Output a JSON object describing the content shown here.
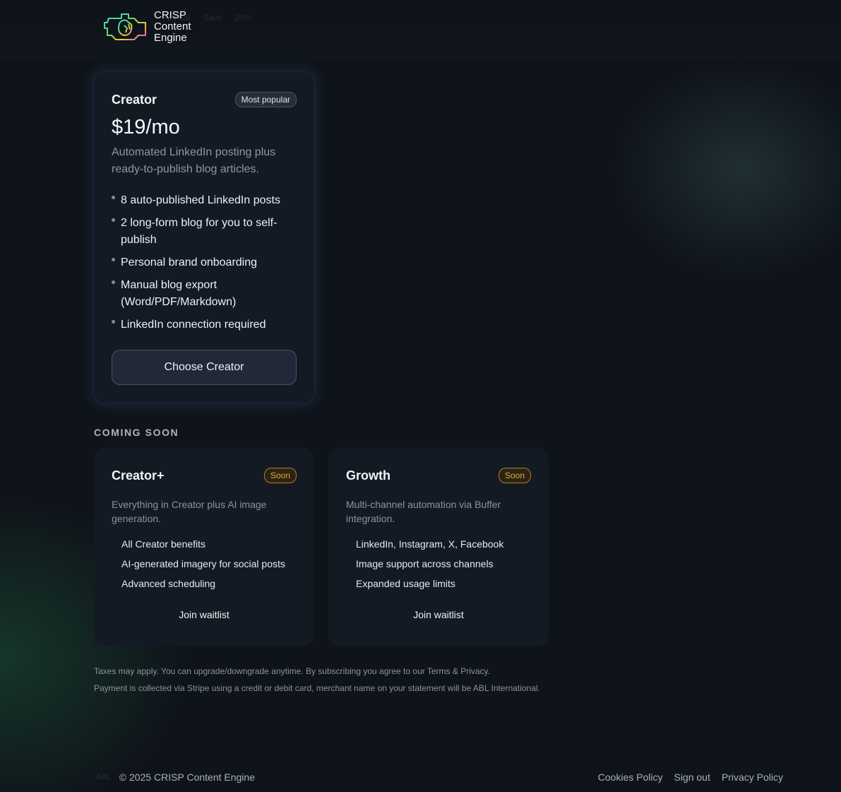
{
  "header": {
    "logo_lines": [
      "CRISP",
      "Content",
      "Engine"
    ],
    "ghost_nav": [
      "Annual",
      "Save",
      "20%"
    ]
  },
  "featured_plan": {
    "name": "Creator",
    "badge": "Most popular",
    "price": "$19/mo",
    "description": "Automated LinkedIn posting plus ready-to-publish blog articles.",
    "features": [
      "8 auto-published LinkedIn posts",
      "2 long-form blog for you to self-publish",
      "Personal brand onboarding",
      "Manual blog export (Word/PDF/Markdown)",
      "LinkedIn connection required"
    ],
    "cta": "Choose Creator"
  },
  "coming_soon": {
    "heading": "COMING SOON",
    "plans": [
      {
        "name": "Creator+",
        "badge": "Soon",
        "description": "Everything in Creator plus AI image generation.",
        "features": [
          "All Creator benefits",
          "AI-generated imagery for social posts",
          "Advanced scheduling"
        ],
        "cta": "Join waitlist"
      },
      {
        "name": "Growth",
        "badge": "Soon",
        "description": "Multi-channel automation via Buffer integration.",
        "features": [
          "LinkedIn, Instagram, X, Facebook",
          "Image support across channels",
          "Expanded usage limits"
        ],
        "cta": "Join waitlist"
      }
    ]
  },
  "fineprint": {
    "line1": "Taxes may apply. You can upgrade/downgrade anytime. By subscribing you agree to our Terms & Privacy.",
    "line2": "Payment is collected via Stripe using a credit or debit card, merchant name on your statement will be ABL International."
  },
  "footer": {
    "ghost_mark": "ABL",
    "copyright": "© 2025 CRISP Content Engine",
    "links": [
      "Cookies Policy",
      "Sign out",
      "Privacy Policy"
    ]
  },
  "colors": {
    "background": "#0f141a",
    "card": "#151b25",
    "soon_badge": "#e5a93b",
    "muted_text": "#8e97a6"
  }
}
